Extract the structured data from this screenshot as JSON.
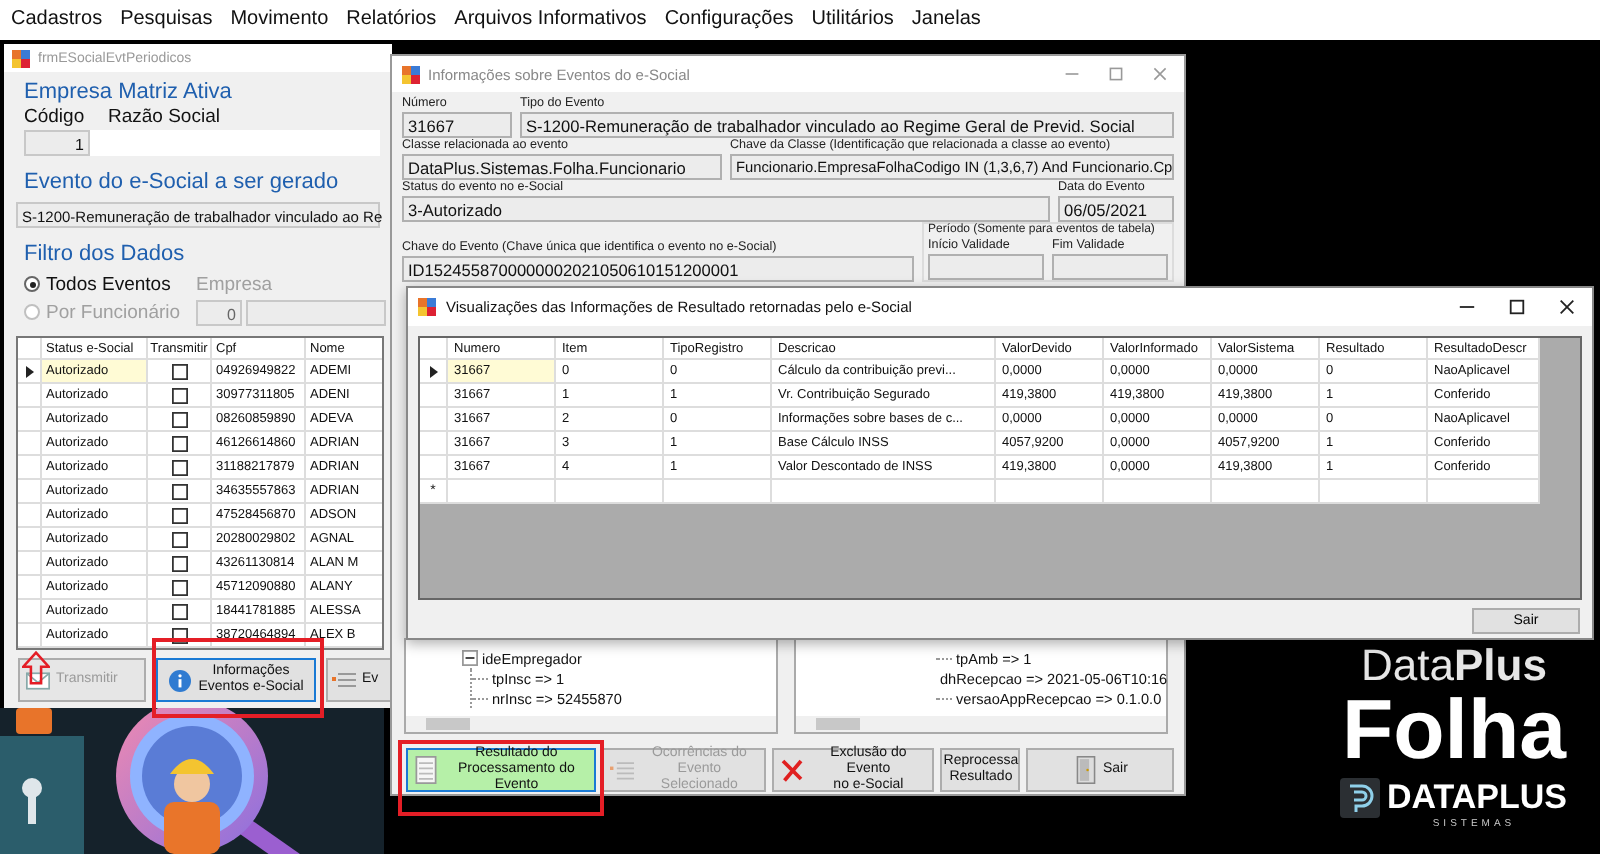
{
  "menu_bar": [
    "Cadastros",
    "Pesquisas",
    "Movimento",
    "Relatórios",
    "Arquivos Informativos",
    "Configurações",
    "Utilitários",
    "Janelas"
  ],
  "main_window": {
    "title": "frmESocialEvtPeriodicos",
    "company": {
      "heading": "Empresa Matriz Ativa",
      "code_label": "Código",
      "name_label": "Razão Social",
      "code": "1"
    },
    "event": {
      "heading": "Evento do e-Social a ser gerado",
      "value": "S-1200-Remuneração de trabalhador vinculado ao Re"
    },
    "filter": {
      "heading": "Filtro dos Dados",
      "company_label": "Empresa",
      "company_value": "0",
      "options": [
        {
          "label": "Todos Eventos",
          "selected": true,
          "disabled": false
        },
        {
          "label": "Por Funcionário",
          "selected": false,
          "disabled": true
        }
      ]
    },
    "grid": {
      "columns": [
        "Status e-Social",
        "Transmitir",
        "Cpf",
        "Nome"
      ],
      "rows": [
        {
          "status": "Autorizado",
          "transmit": false,
          "cpf": "04926949822",
          "name": "ADEMI",
          "selected": true
        },
        {
          "status": "Autorizado",
          "transmit": false,
          "cpf": "30977311805",
          "name": "ADENI",
          "selected": false
        },
        {
          "status": "Autorizado",
          "transmit": false,
          "cpf": "08260859890",
          "name": "ADEVA",
          "selected": false
        },
        {
          "status": "Autorizado",
          "transmit": false,
          "cpf": "46126614860",
          "name": "ADRIAN",
          "selected": false
        },
        {
          "status": "Autorizado",
          "transmit": false,
          "cpf": "31188217879",
          "name": "ADRIAN",
          "selected": false
        },
        {
          "status": "Autorizado",
          "transmit": false,
          "cpf": "34635557863",
          "name": "ADRIAN",
          "selected": false
        },
        {
          "status": "Autorizado",
          "transmit": false,
          "cpf": "47528456870",
          "name": "ADSON",
          "selected": false
        },
        {
          "status": "Autorizado",
          "transmit": false,
          "cpf": "20280029802",
          "name": "AGNAL",
          "selected": false
        },
        {
          "status": "Autorizado",
          "transmit": false,
          "cpf": "43261130814",
          "name": "ALAN M",
          "selected": false
        },
        {
          "status": "Autorizado",
          "transmit": false,
          "cpf": "45712090880",
          "name": "ALANY",
          "selected": false
        },
        {
          "status": "Autorizado",
          "transmit": false,
          "cpf": "18441781885",
          "name": "ALESSA",
          "selected": false
        },
        {
          "status": "Autorizado",
          "transmit": false,
          "cpf": "38720464894",
          "name": "ALEX B",
          "selected": false
        }
      ]
    },
    "buttons": [
      {
        "label": "Transmitir",
        "kind": "transmit",
        "disabled": true,
        "focused": false
      },
      {
        "label": "Informações\nEventos e-Social",
        "kind": "info",
        "disabled": false,
        "focused": true
      },
      {
        "label": "Ev",
        "kind": "list",
        "disabled": false,
        "focused": false
      }
    ]
  },
  "events_window": {
    "title": "Informações sobre Eventos do e-Social",
    "number": {
      "label": "Número",
      "value": "31667"
    },
    "event_type": {
      "label": "Tipo do Evento",
      "value": "S-1200-Remuneração de trabalhador vinculado ao Regime Geral de Previd. Social"
    },
    "class": {
      "label": "Classe relacionada ao evento",
      "value": "DataPlus.Sistemas.Folha.Funcionario"
    },
    "class_key": {
      "label": "Chave da Classe (Identificação que relacionada a classe ao evento)",
      "value": "Funcionario.EmpresaFolhaCodigo IN (1,3,6,7) And Funcionario.Cp"
    },
    "status": {
      "label": "Status do evento no e-Social",
      "value": "3-Autorizado"
    },
    "event_date": {
      "label": "Data do Evento",
      "value": "06/05/2021"
    },
    "event_key": {
      "label": "Chave do Evento (Chave única que identifica o evento no e-Social)",
      "value": "ID1524558700000002021050610151200001"
    },
    "period": {
      "heading": "Período (Somente para eventos de tabela)",
      "start_label": "Início Validade",
      "end_label": "Fim Validade"
    },
    "left_tree": [
      {
        "label": "ideEmpregador",
        "expanded": true,
        "children": [
          {
            "label": "tpInsc => 1"
          },
          {
            "label": "nrInsc => 52455870"
          }
        ]
      }
    ],
    "right_tree": [
      {
        "label": "tpAmb => 1"
      },
      {
        "label": "dhRecepcao => 2021-05-06T10:16"
      },
      {
        "label": "versaoAppRecepcao => 0.1.0.0"
      }
    ],
    "buttons": [
      {
        "label": "Resultado do\nProcessamento do Evento",
        "kind": "result",
        "disabled": false,
        "focused": true
      },
      {
        "label": "Ocorrências do\nEvento Selecionado",
        "kind": "list",
        "disabled": true,
        "focused": false
      },
      {
        "label": "Exclusão do Evento\nno e-Social",
        "kind": "delete",
        "disabled": false,
        "focused": false
      },
      {
        "label": "Reprocessa\nResultado",
        "kind": "plain",
        "disabled": false,
        "focused": false
      },
      {
        "label": "Sair",
        "kind": "exit",
        "disabled": false,
        "focused": false
      }
    ]
  },
  "results_window": {
    "title": "Visualizações das Informações de Resultado retornadas pelo e-Social",
    "columns": [
      "Numero",
      "Item",
      "TipoRegistro",
      "Descricao",
      "ValorDevido",
      "ValorInformado",
      "ValorSistema",
      "Resultado",
      "ResultadoDescr"
    ],
    "rows": [
      {
        "cells": [
          "31667",
          "0",
          "0",
          "Cálculo da contribuição previ...",
          "0,0000",
          "0,0000",
          "0,0000",
          "0",
          "NaoAplicavel"
        ],
        "selected": true
      },
      {
        "cells": [
          "31667",
          "1",
          "1",
          "Vr. Contribuição Segurado",
          "419,3800",
          "419,3800",
          "419,3800",
          "1",
          "Conferido"
        ],
        "selected": false
      },
      {
        "cells": [
          "31667",
          "2",
          "0",
          "Informações sobre bases de c...",
          "0,0000",
          "0,0000",
          "0,0000",
          "0",
          "NaoAplicavel"
        ],
        "selected": false
      },
      {
        "cells": [
          "31667",
          "3",
          "1",
          "Base Cálculo INSS",
          "4057,9200",
          "0,0000",
          "4057,9200",
          "1",
          "Conferido"
        ],
        "selected": false
      },
      {
        "cells": [
          "31667",
          "4",
          "1",
          "Valor Descontado de INSS",
          "419,3800",
          "0,0000",
          "419,3800",
          "1",
          "Conferido"
        ],
        "selected": false
      }
    ],
    "new_row_marker": "*",
    "close_button": "Sair"
  },
  "logo": {
    "product_top": "Data**Plus**",
    "product": "Folha",
    "brand": "DATAPLUS",
    "tagline": "SISTEMAS"
  }
}
